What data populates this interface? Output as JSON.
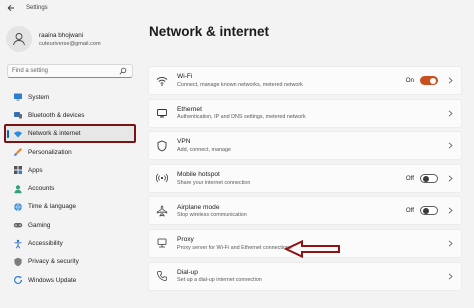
{
  "window": {
    "title": "Settings"
  },
  "profile": {
    "name": "raaina bhojwani",
    "email": "cuteuriverse@gmail.com"
  },
  "search": {
    "placeholder": "Find a setting"
  },
  "nav": {
    "items": [
      {
        "label": "System",
        "icon": "monitor-icon"
      },
      {
        "label": "Bluetooth & devices",
        "icon": "bluetooth-icon"
      },
      {
        "label": "Network & internet",
        "icon": "wifi-icon",
        "selected": true
      },
      {
        "label": "Personalization",
        "icon": "brush-icon"
      },
      {
        "label": "Apps",
        "icon": "apps-icon"
      },
      {
        "label": "Accounts",
        "icon": "person-icon"
      },
      {
        "label": "Time & language",
        "icon": "globe-icon"
      },
      {
        "label": "Gaming",
        "icon": "gamepad-icon"
      },
      {
        "label": "Accessibility",
        "icon": "accessibility-icon"
      },
      {
        "label": "Privacy & security",
        "icon": "shield-icon"
      },
      {
        "label": "Windows Update",
        "icon": "update-icon"
      }
    ]
  },
  "main": {
    "title": "Network & internet",
    "cards": [
      {
        "title": "Wi-Fi",
        "subtitle": "Connect, manage known networks, metered network",
        "toggle_label": "On",
        "toggle_on": true
      },
      {
        "title": "Ethernet",
        "subtitle": "Authentication, IP and DNS settings, metered network"
      },
      {
        "title": "VPN",
        "subtitle": "Add, connect, manage"
      },
      {
        "title": "Mobile hotspot",
        "subtitle": "Share your internet connection",
        "toggle_label": "Off",
        "toggle_on": false
      },
      {
        "title": "Airplane mode",
        "subtitle": "Stop wireless communication",
        "toggle_label": "Off",
        "toggle_on": false
      },
      {
        "title": "Proxy",
        "subtitle": "Proxy server for Wi-Fi and Ethernet connections"
      },
      {
        "title": "Dial-up",
        "subtitle": "Set up a dial-up internet connection"
      }
    ]
  },
  "colors": {
    "accent": "#0067c0",
    "toggle_on": "#c8501e",
    "annotation": "#7a1414"
  }
}
